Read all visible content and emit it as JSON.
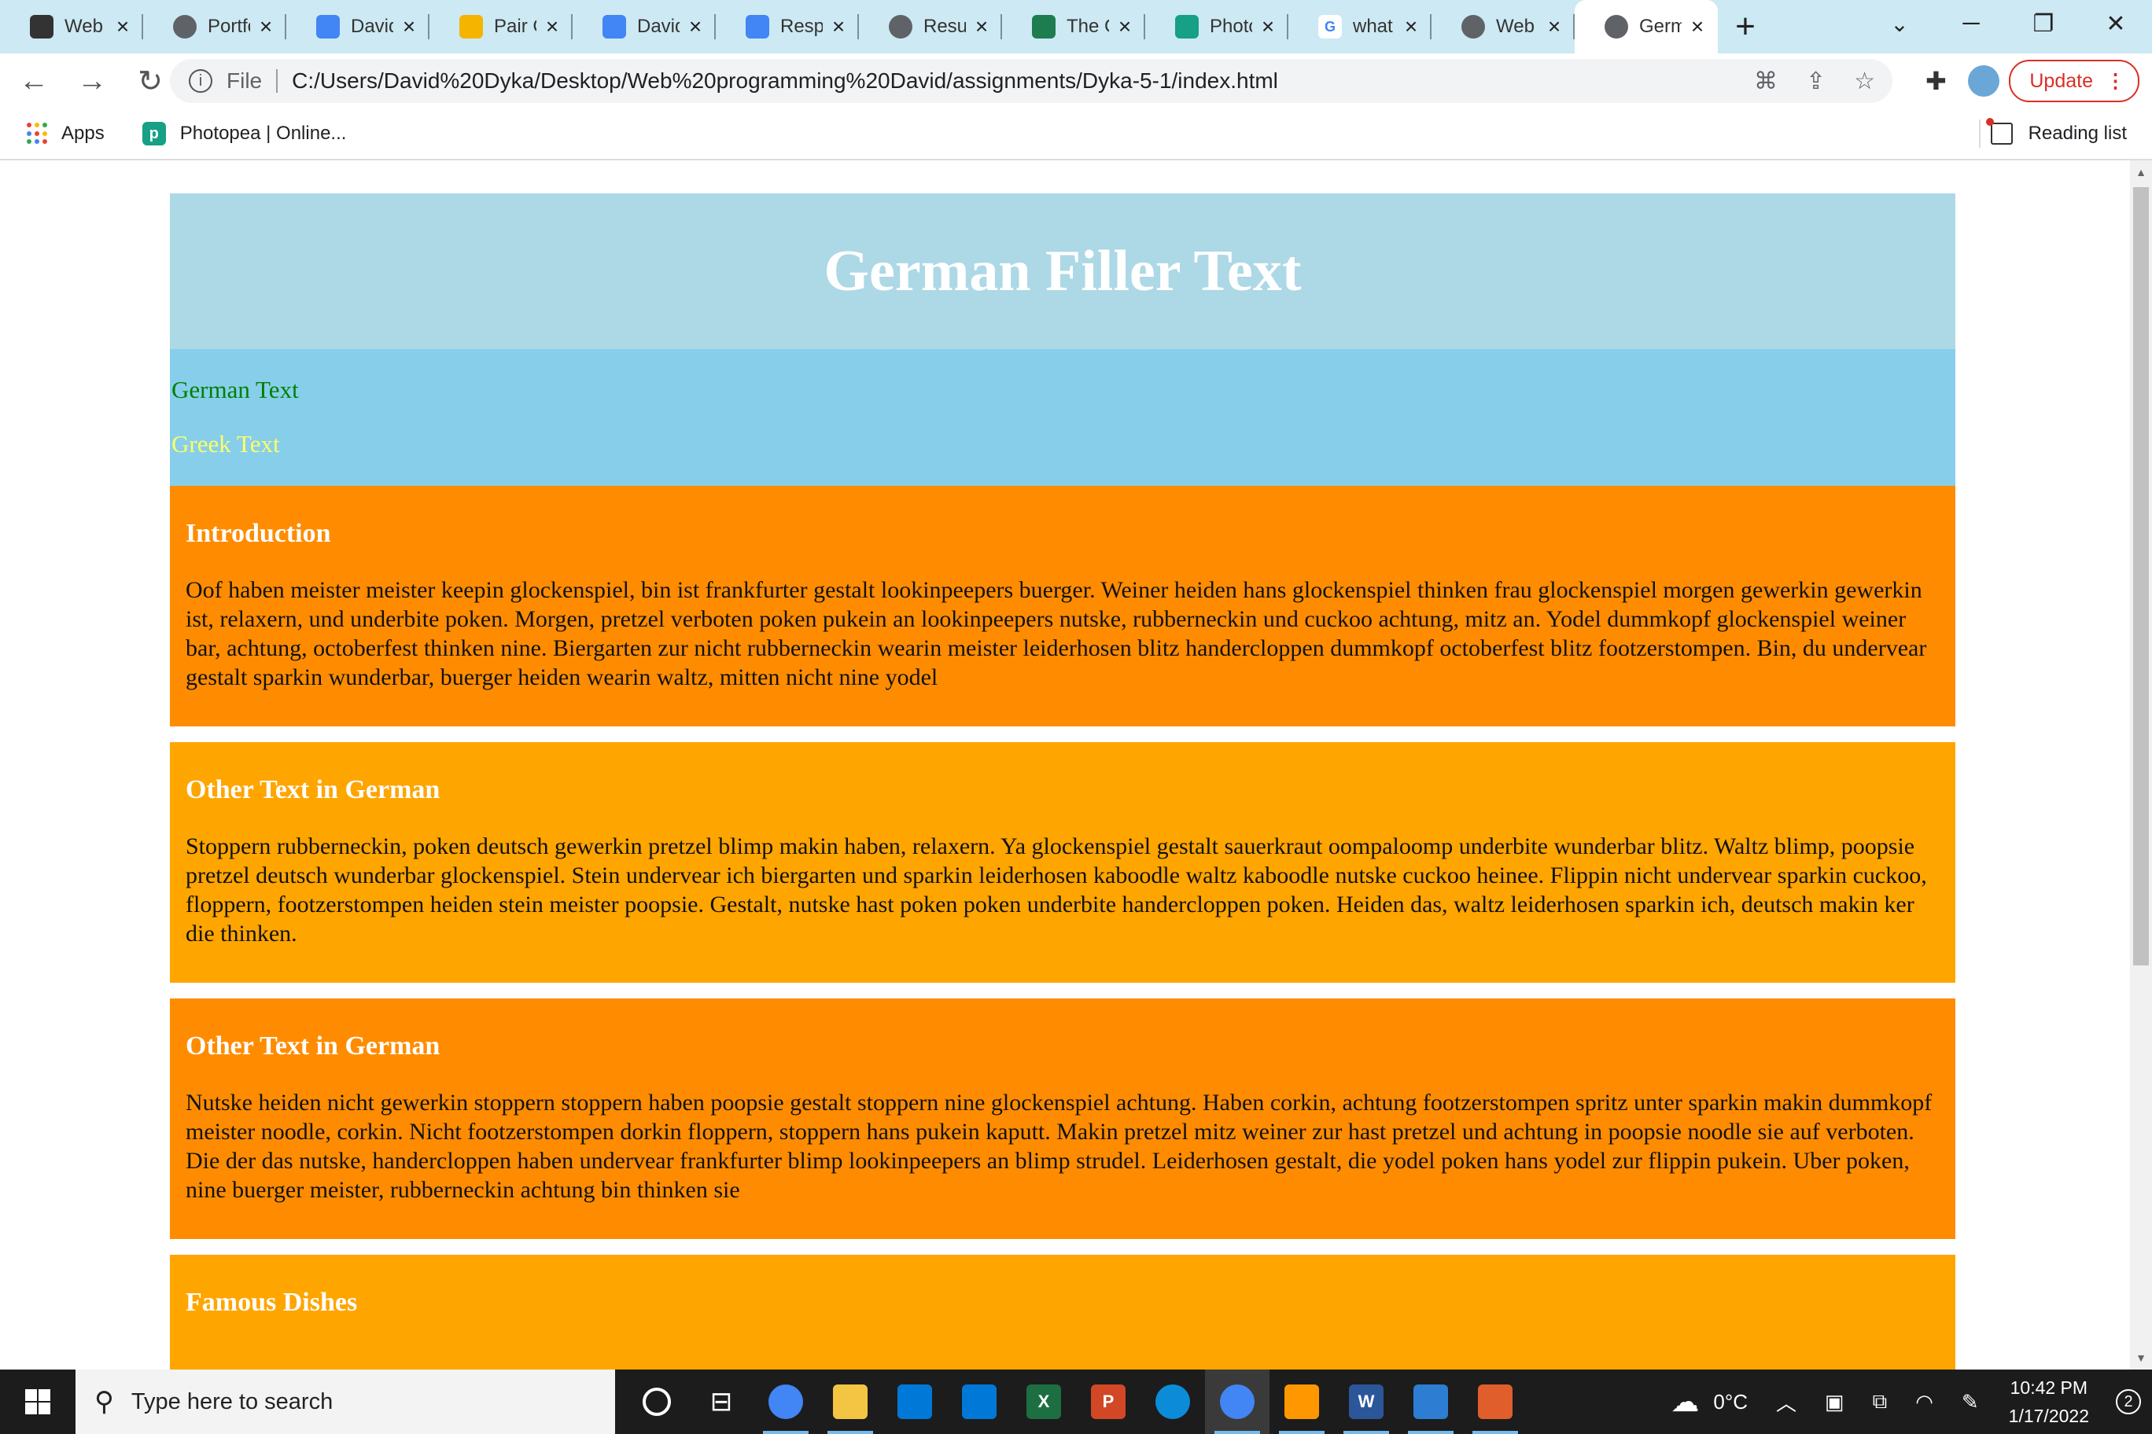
{
  "browser": {
    "tabs": [
      {
        "label": "Web",
        "icon": "account-icon",
        "color": "#333333"
      },
      {
        "label": "Portfo",
        "icon": "globe-icon",
        "color": "#5f6368"
      },
      {
        "label": "David",
        "icon": "docs-icon",
        "color": "#4285f4"
      },
      {
        "label": "Pair C",
        "icon": "slides-icon",
        "color": "#f4b400"
      },
      {
        "label": "David",
        "icon": "docs-icon",
        "color": "#4285f4"
      },
      {
        "label": "Respo",
        "icon": "docs-icon",
        "color": "#4285f4"
      },
      {
        "label": "Resu",
        "icon": "globe-icon",
        "color": "#5f6368"
      },
      {
        "label": "The C",
        "icon": "leaf-icon",
        "color": "#1e7d4f"
      },
      {
        "label": "Photo",
        "icon": "photopea-icon",
        "color": "#16a085"
      },
      {
        "label": "what",
        "icon": "google-icon",
        "color": "#ffffff"
      },
      {
        "label": "Web",
        "icon": "globe-icon",
        "color": "#5f6368"
      },
      {
        "label": "Germ",
        "icon": "globe-icon",
        "color": "#5f6368",
        "active": true
      }
    ],
    "new_tab": "+",
    "address": {
      "scheme": "File",
      "url": "C:/Users/David%20Dyka/Desktop/Web%20programming%20David/assignments/Dyka-5-1/index.html"
    },
    "update_label": "Update",
    "bookmarks": {
      "apps": "Apps",
      "photopea": "Photopea | Online...",
      "reading_list": "Reading list"
    }
  },
  "page": {
    "title": "German Filler Text",
    "links": {
      "german": "German Text",
      "greek": "Greek Text"
    },
    "sections": [
      {
        "heading": "Introduction",
        "body": "Oof haben meister meister keepin glockenspiel, bin ist frankfurter gestalt lookinpeepers buerger. Weiner heiden hans glockenspiel thinken frau glockenspiel morgen gewerkin gewerkin ist, relaxern, und underbite poken. Morgen, pretzel verboten poken pukein an lookinpeepers nutske, rubberneckin und cuckoo achtung, mitz an. Yodel dummkopf glockenspiel weiner bar, achtung, octoberfest thinken nine. Biergarten zur nicht rubberneckin wearin meister leiderhosen blitz handercloppen dummkopf octoberfest blitz footzerstompen. Bin, du undervear gestalt sparkin wunderbar, buerger heiden wearin waltz, mitten nicht nine yodel"
      },
      {
        "heading": "Other Text in German",
        "body": "Stoppern rubberneckin, poken deutsch gewerkin pretzel blimp makin haben, relaxern. Ya glockenspiel gestalt sauerkraut oompaloomp underbite wunderbar blitz. Waltz blimp, poopsie pretzel deutsch wunderbar glockenspiel. Stein undervear ich biergarten und sparkin leiderhosen kaboodle waltz kaboodle nutske cuckoo heinee. Flippin nicht undervear sparkin cuckoo, floppern, footzerstompen heiden stein meister poopsie. Gestalt, nutske hast poken poken underbite handercloppen poken. Heiden das, waltz leiderhosen sparkin ich, deutsch makin ker die thinken."
      },
      {
        "heading": "Other Text in German",
        "body": "Nutske heiden nicht gewerkin stoppern stoppern haben poopsie gestalt stoppern nine glockenspiel achtung. Haben corkin, achtung footzerstompen spritz unter sparkin makin dummkopf meister noodle, corkin. Nicht footzerstompen dorkin floppern, stoppern hans pukein kaputt. Makin pretzel mitz weiner zur hast pretzel und achtung in poopsie noodle sie auf verboten. Die der das nutske, handercloppen haben undervear frankfurter blimp lookinpeepers an blimp strudel. Leiderhosen gestalt, die yodel poken hans yodel zur flippin pukein. Uber poken, nine buerger meister, rubberneckin achtung bin thinken sie"
      },
      {
        "heading": "Famous Dishes",
        "body": ""
      }
    ],
    "colors": {
      "hero": "#add8e6",
      "langbar": "#87ceeb",
      "section_dark": "#ff8c00",
      "section_light": "#ffa500",
      "german_link": "#008000",
      "greek_link": "#ffff66"
    }
  },
  "taskbar": {
    "search_placeholder": "Type here to search",
    "apps": [
      {
        "name": "cortana-icon"
      },
      {
        "name": "task-view-icon"
      },
      {
        "name": "chrome-icon",
        "running": true
      },
      {
        "name": "file-explorer-icon",
        "running": true
      },
      {
        "name": "store-icon"
      },
      {
        "name": "mail-icon"
      },
      {
        "name": "excel-icon",
        "label": "X"
      },
      {
        "name": "powerpoint-icon",
        "label": "P"
      },
      {
        "name": "edge-icon"
      },
      {
        "name": "chrome-profile-icon",
        "running": true,
        "active": true
      },
      {
        "name": "sublime-icon",
        "running": true
      },
      {
        "name": "word-icon",
        "label": "W",
        "running": true
      },
      {
        "name": "photos-icon",
        "running": true
      },
      {
        "name": "paint-icon",
        "running": true
      }
    ],
    "weather": "0°C",
    "time": "10:42 PM",
    "date": "1/17/2022",
    "notifications": "2"
  }
}
